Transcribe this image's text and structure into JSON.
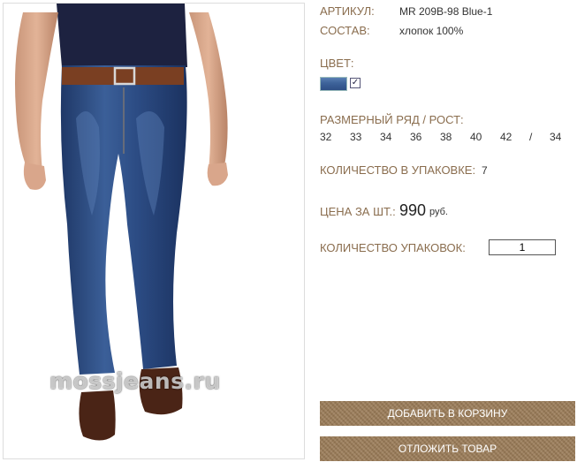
{
  "product": {
    "article_label": "АРТИКУЛ:",
    "article_value": "MR 209B-98 Blue-1",
    "composition_label": "СОСТАВ:",
    "composition_value": "хлопок 100%",
    "color_label": "ЦВЕТ:",
    "color_swatch_hex": "#3d6299",
    "color_checked": true,
    "size_label": "РАЗМЕРНЫЙ РЯД / РОСТ:",
    "sizes": [
      "32",
      "33",
      "34",
      "36",
      "38",
      "40",
      "42",
      "/",
      "34"
    ],
    "pack_qty_label": "КОЛИЧЕСТВО В УПАКОВКЕ:",
    "pack_qty_value": "7",
    "price_label": "ЦЕНА ЗА ШТ.:",
    "price_value": "990",
    "price_currency": "руб.",
    "packs_label": "КОЛИЧЕСТВО УПАКОВОК:",
    "packs_input_value": "1"
  },
  "image": {
    "watermark": "mossjeans.ru"
  },
  "actions": {
    "add_to_cart": "ДОБАВИТЬ В КОРЗИНУ",
    "postpone": "ОТЛОЖИТЬ ТОВАР"
  },
  "colors": {
    "label_brown": "#8a6d4e",
    "button_brown": "#9a7b57"
  }
}
